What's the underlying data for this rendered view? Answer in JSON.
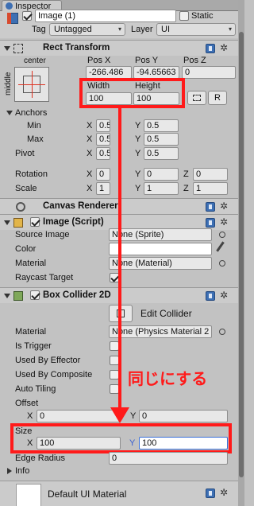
{
  "window": {
    "tab_title": "Inspector"
  },
  "gameobject": {
    "name": "Image (1)",
    "static_label": "Static",
    "tag_label": "Tag",
    "tag_value": "Untagged",
    "layer_label": "Layer",
    "layer_value": "UI"
  },
  "rect_transform": {
    "title": "Rect Transform",
    "anchor_h": "center",
    "anchor_v": "middle",
    "pos_x_label": "Pos X",
    "pos_y_label": "Pos Y",
    "pos_z_label": "Pos Z",
    "pos_x": "-266.486",
    "pos_y": "-94.65663",
    "pos_z": "0",
    "width_label": "Width",
    "height_label": "Height",
    "width": "100",
    "height": "100",
    "r_button": "R",
    "anchors_label": "Anchors",
    "min_label": "Min",
    "max_label": "Max",
    "min_x": "0.5",
    "min_y": "0.5",
    "max_x": "0.5",
    "max_y": "0.5",
    "pivot_label": "Pivot",
    "pivot_x": "0.5",
    "pivot_y": "0.5",
    "rotation_label": "Rotation",
    "rot_x": "0",
    "rot_y": "0",
    "rot_z": "0",
    "scale_label": "Scale",
    "scale_x": "1",
    "scale_y": "1",
    "scale_z": "1",
    "x": "X",
    "y": "Y",
    "z": "Z"
  },
  "canvas_renderer": {
    "title": "Canvas Renderer"
  },
  "image_script": {
    "title": "Image (Script)",
    "source_image_label": "Source Image",
    "source_image_value": "None (Sprite)",
    "color_label": "Color",
    "material_label": "Material",
    "material_value": "None (Material)",
    "raycast_label": "Raycast Target"
  },
  "box_collider": {
    "title": "Box Collider 2D",
    "edit_collider": "Edit Collider",
    "material_label": "Material",
    "material_value": "None (Physics Material 2",
    "is_trigger_label": "Is Trigger",
    "used_by_effector_label": "Used By Effector",
    "used_by_composite_label": "Used By Composite",
    "auto_tiling_label": "Auto Tiling",
    "offset_label": "Offset",
    "offset_x": "0",
    "offset_y": "0",
    "size_label": "Size",
    "size_x": "100",
    "size_y": "100",
    "edge_radius_label": "Edge Radius",
    "edge_radius": "0",
    "info_label": "Info"
  },
  "default_material": {
    "title": "Default UI Material"
  },
  "annotation": {
    "text": "同じにする",
    "color": "#ff1a1a"
  }
}
